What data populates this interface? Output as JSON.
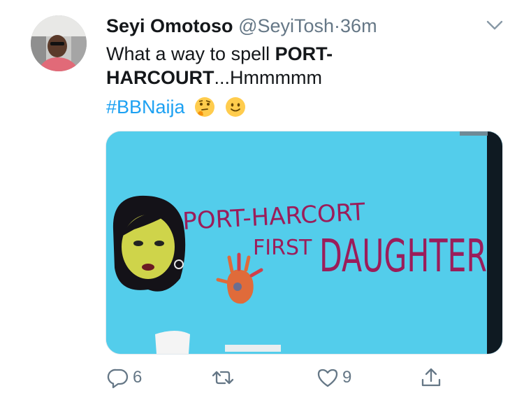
{
  "tweet": {
    "author_name": "Seyi Omotoso",
    "handle": "@SeyiTosh",
    "separator": "·",
    "time": "36m",
    "text_prefix": "What a way to spell ",
    "text_bold_1": "PORT-",
    "text_bold_2": "HARCOURT",
    "text_suffix": "...Hmmmmm",
    "hashtag": "#BBNaija",
    "emojis": [
      "thinking-face-emoji",
      "slightly-smiling-face-emoji"
    ]
  },
  "media": {
    "painted_text_line1": "PORT-HARCORT",
    "painted_text_line2": "FIRST",
    "painted_text_line3": "DAUGHTER",
    "background_color": "#4fc9e8"
  },
  "actions": {
    "reply_count": "6",
    "retweet_count": "",
    "like_count": "9",
    "share_label": ""
  },
  "colors": {
    "primary_text": "#14171a",
    "secondary_text": "#657786",
    "link": "#1da1f2"
  }
}
